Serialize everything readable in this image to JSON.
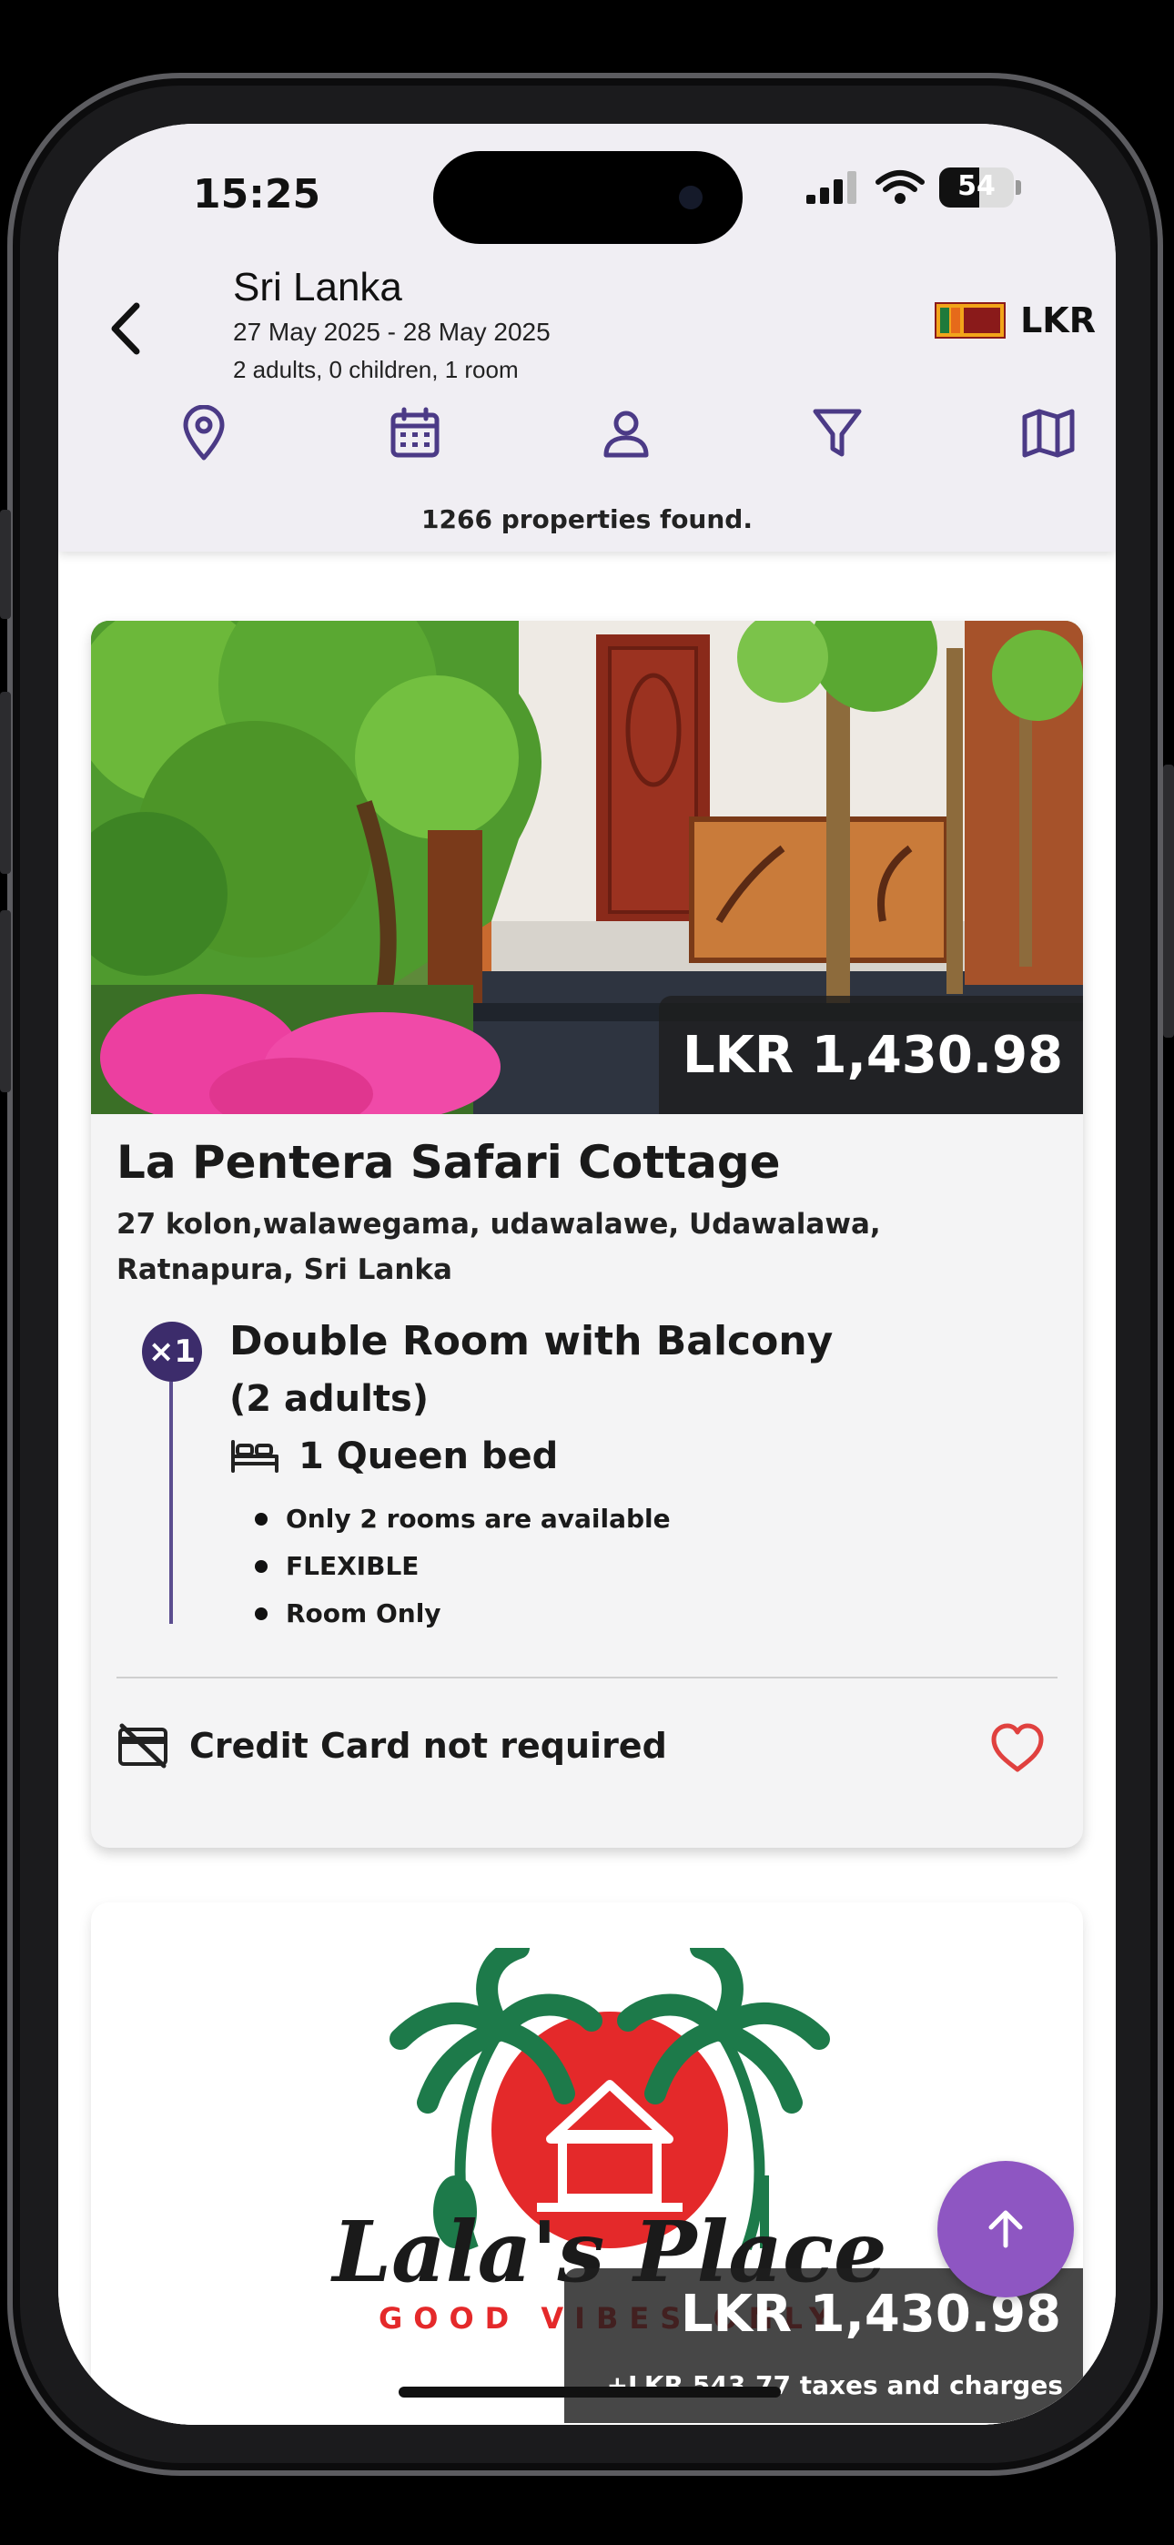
{
  "status_bar": {
    "time": "15:25",
    "battery": "54",
    "battery_level": 0.54
  },
  "header": {
    "destination": "Sri Lanka",
    "dates": "27 May 2025 - 28 May 2025",
    "guests": "2 adults, 0 children, 1 room",
    "currency": "LKR",
    "results_count": "1266 properties found."
  },
  "toolbar": {
    "icons": [
      "location-pin-icon",
      "calendar-icon",
      "person-icon",
      "filter-icon",
      "map-icon"
    ]
  },
  "listings": [
    {
      "price": "LKR 1,430.98",
      "name": "La Pentera Safari Cottage",
      "address": "27 kolon,walawegama, udawalawe, Udawalawa, Ratnapura, Sri Lanka",
      "room_qty": "×1",
      "room_name": "Double Room with Balcony",
      "occupancy": "(2 adults)",
      "bed": "1 Queen bed",
      "features": [
        "Only 2 rooms are available",
        "FLEXIBLE",
        "Room Only"
      ],
      "credit_card_note": "Credit Card not required"
    },
    {
      "price": "LKR 1,430.98",
      "taxes": "+LKR 543.77 taxes and charges",
      "logo_text": "Lala's Place",
      "logo_tagline": "GOOD VIBES ONLY"
    }
  ],
  "colors": {
    "accent": "#5b4d8f",
    "fab": "#8e56c2",
    "heart": "#e0413f",
    "header_bg": "#f0eef3"
  }
}
